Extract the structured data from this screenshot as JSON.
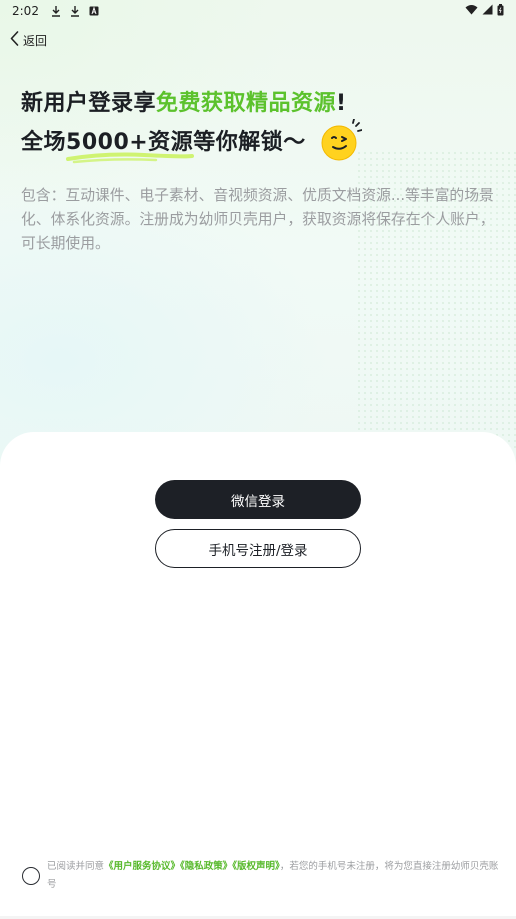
{
  "status_bar": {
    "time": "2:02",
    "left_icons": [
      "download-icon",
      "download-icon",
      "font-icon"
    ],
    "right_icons": [
      "wifi-icon",
      "signal-icon",
      "battery-icon"
    ]
  },
  "nav": {
    "back_label": "返回"
  },
  "hero": {
    "line1_prefix": "新用户登录享",
    "line1_highlight": "免费获取精品资源",
    "line1_suffix": "!",
    "line2_prefix": "全场",
    "line2_underlined": "5000+资源",
    "line2_suffix": "等你解锁～",
    "description": "包含：互动课件、电子素材、音视频资源、优质文档资源...等丰富的场景化、体系化资源。注册成为幼师贝壳用户，获取资源将保存在个人账户，可长期使用。"
  },
  "actions": {
    "wechat_login": "微信登录",
    "phone_login": "手机号注册/登录"
  },
  "agreement": {
    "prefix": "已阅读并同意",
    "link_terms": "《用户服务协议》",
    "link_privacy": "《隐私政策》",
    "link_copyright": "《版权声明》",
    "suffix": "，若您的手机号未注册，将为您直接注册幼师贝壳账号",
    "checked": false
  },
  "colors": {
    "accent_green": "#5cc22d",
    "button_dark": "#1d2026",
    "muted_text": "#9b9da0"
  }
}
